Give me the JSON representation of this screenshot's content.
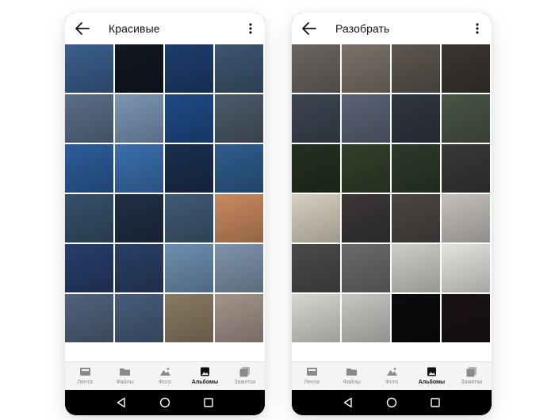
{
  "screens": [
    {
      "title": "Красивые",
      "active_tab": 3,
      "photos": [
        "#3a5f8c",
        "#121821",
        "#1e3d6d",
        "#3d5670",
        "#5a6e88",
        "#7b95b5",
        "#1f4a86",
        "#4d5a6a",
        "#2c5d9a",
        "#3b6fae",
        "#1a2f4e",
        "#2f5c8e",
        "#36506a",
        "#1f2f45",
        "#405a74",
        "#c98a5e",
        "#273d6a",
        "#2a3f66",
        "#6c8fb0",
        "#7d93ab",
        "#50627c",
        "#475d7a",
        "#8a7a62",
        "#a4938a",
        "#2e4464",
        "#b0bfcf",
        "#4d5f78",
        "#6a7a90"
      ]
    },
    {
      "title": "Разобрать",
      "active_tab": 3,
      "photos": [
        "#6a6560",
        "#7b7268",
        "#5d5650",
        "#3b3530",
        "#3d4552",
        "#5a6476",
        "#303640",
        "#4a5544",
        "#23301f",
        "#31402a",
        "#2c3a28",
        "#3a3836",
        "#d8d0c0",
        "#3a3736",
        "#4a4644",
        "#c4c0bc",
        "#4a4a4a",
        "#6a6a6a",
        "#cfcdc8",
        "#e4e3df",
        "#d8d6d0",
        "#c8c6c2",
        "#0c0a0c",
        "#1a1214",
        "#d81f9c",
        "#e03aa8",
        "#c92895",
        "#d93aa4"
      ]
    }
  ],
  "nav": {
    "items": [
      {
        "label": "Лента",
        "icon": "feed-icon"
      },
      {
        "label": "Файлы",
        "icon": "folder-icon"
      },
      {
        "label": "Фото",
        "icon": "photo-icon"
      },
      {
        "label": "Альбомы",
        "icon": "albums-icon"
      },
      {
        "label": "Заметки",
        "icon": "notes-icon"
      }
    ]
  },
  "system_nav": [
    "back-triangle-icon",
    "home-circle-icon",
    "recents-square-icon"
  ],
  "colors": {
    "nav_active": "#111111",
    "nav_inactive": "#8a8a8a",
    "nav_bg": "#f4f4f4",
    "phone_frame": "#000000"
  }
}
